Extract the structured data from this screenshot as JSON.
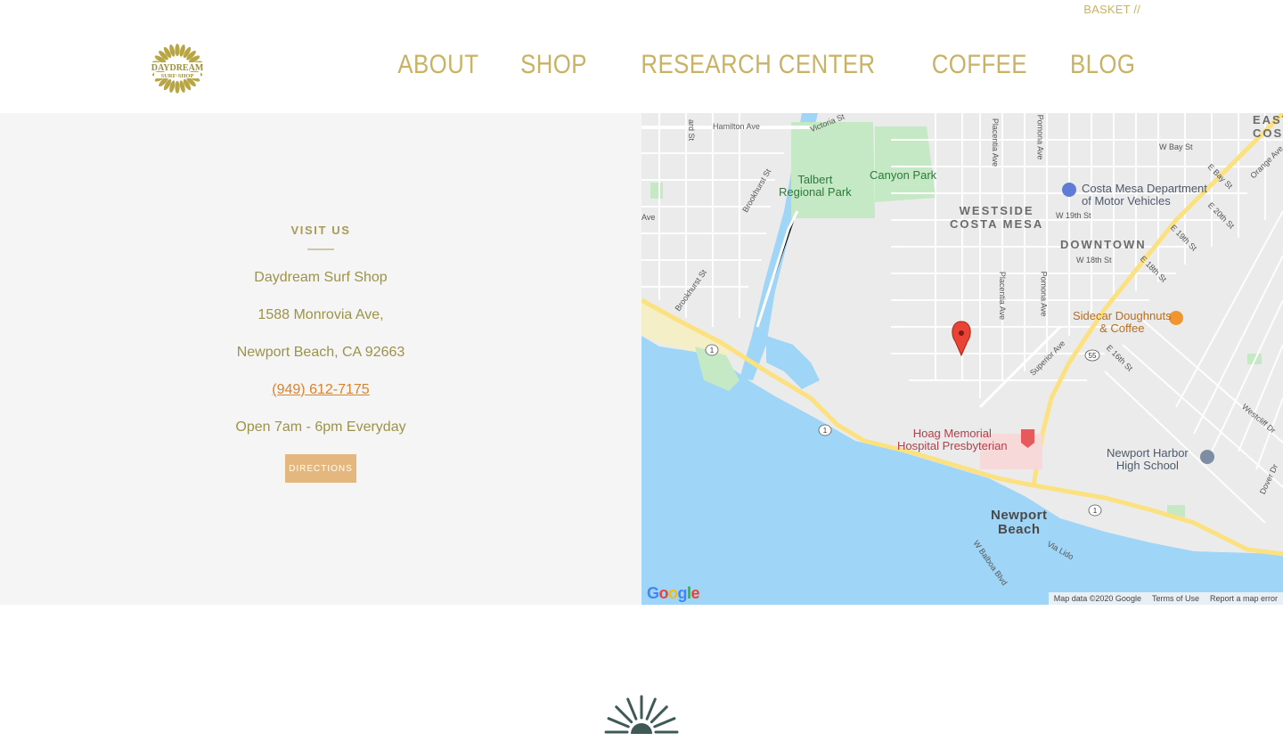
{
  "header": {
    "basket_label": "BASKET //",
    "logo_text_top": "DAYDREAM",
    "logo_text_bottom": "SURF·SHOP",
    "nav": [
      "ABOUT",
      "SHOP",
      "RESEARCH CENTER",
      "COFFEE",
      "BLOG"
    ]
  },
  "visit": {
    "title": "VISIT US",
    "shop_name": "Daydream Surf Shop",
    "street": "1588 Monrovia Ave,",
    "city_line": "Newport Beach, CA 92663",
    "phone": "(949) 612-7175",
    "hours": "Open 7am - 6pm Everyday",
    "directions_label": "DIRECTIONS"
  },
  "map": {
    "labels": {
      "hamilton": "Hamilton Ave",
      "victoria": "Victoria St",
      "placentia_top": "Placentia Ave",
      "pomona_top": "Pomona Ave",
      "brookhurst_top": "Brookhurst St",
      "brookhurst_bottom": "Brookhurst St",
      "w_bay": "W Bay St",
      "e_bay": "E Bay St",
      "orange": "Orange Ave",
      "e_20th": "E 20th St",
      "e_19th": "E 19th St",
      "w_19th": "W 19th St",
      "w_18th": "W 18th St",
      "e_18th": "E 18th St",
      "placentia_mid": "Placentia Ave",
      "pomona_mid": "Pomona Ave",
      "superior": "Superior Ave",
      "e_16th": "E 16th St",
      "westcliff": "Westcliff Dr",
      "dover": "Dover Dr",
      "balboa": "W Balboa Blvd",
      "via_lido": "Via Lido",
      "ave_left": "Ave",
      "ard_st": "ard St",
      "talbert": "Talbert\nRegional Park",
      "canyon": "Canyon Park",
      "westside": "WESTSIDE\nCOSTA MESA",
      "downtown": "DOWNTOWN",
      "east_costa": "EAST\nCOSTA",
      "dmv": "Costa Mesa Department\nof Motor Vehicles",
      "sidecar": "Sidecar Doughnuts\n& Coffee",
      "hoag": "Hoag Memorial\nHospital Presbyterian",
      "newport_harbor": "Newport Harbor\nHigh School",
      "newport_beach": "Newport\nBeach",
      "route_1a": "1",
      "route_1b": "1",
      "route_1c": "1",
      "route_55": "55"
    },
    "google": "Google",
    "attribution": {
      "data": "Map data ©2020 Google",
      "terms": "Terms of Use",
      "report": "Report a map error"
    }
  },
  "colors": {
    "gold": "#c9b264",
    "olive_text": "#9d9249",
    "phone": "#d9822b",
    "button": "#e4b77f",
    "panel_bg": "#f5f5f5",
    "water": "#9fd5f7",
    "park": "#c5e8c5",
    "sunburst": "#3f5a56"
  }
}
